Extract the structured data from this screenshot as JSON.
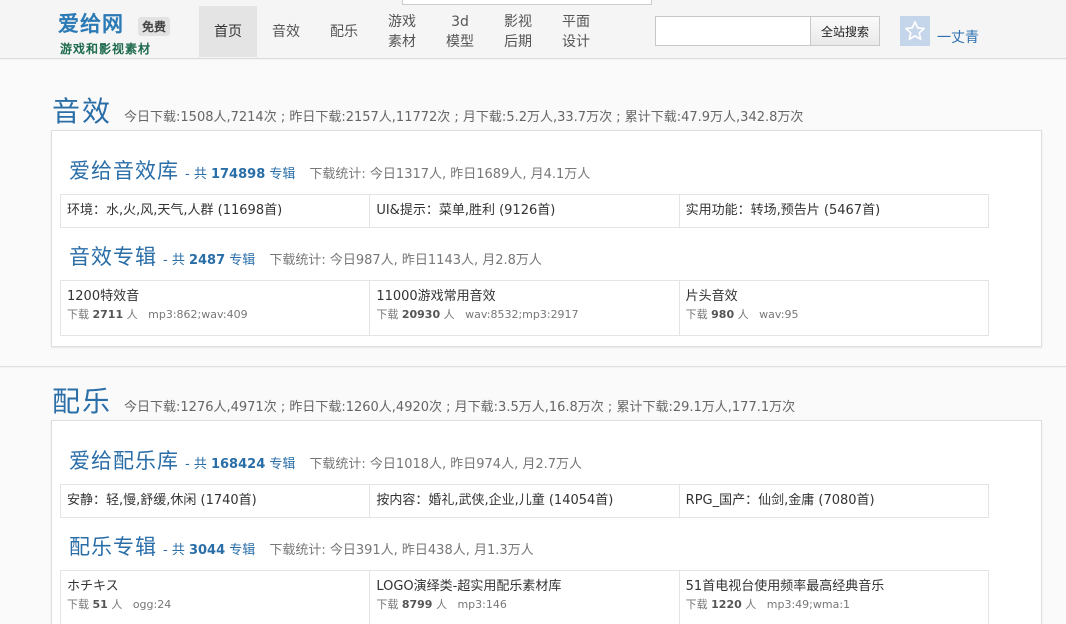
{
  "header": {
    "logo_title": "爱给网",
    "logo_badge": "免费",
    "logo_sub": "游戏和影视素材",
    "nav": [
      {
        "label": "首页"
      },
      {
        "label": "音效"
      },
      {
        "label": "配乐"
      },
      {
        "label": "游戏\n素材"
      },
      {
        "label": "3d\n模型"
      },
      {
        "label": "影视\n后期"
      },
      {
        "label": "平面\n设计"
      }
    ],
    "search": {
      "placeholder": "",
      "button": "全站搜索"
    },
    "user": {
      "name": "一丈青",
      "avatar_icon": "star-icon"
    }
  },
  "sound": {
    "title": "音效",
    "stats": "今日下载:1508人,7214次 ; 昨日下载:2157人,11772次 ; 月下载:5.2万人,33.7万次 ; 累计下载:47.9万人,342.8万次",
    "library": {
      "title": "爱给音效库",
      "count_prefix": "- 共",
      "count": "174898",
      "count_suffix": "专辑",
      "stats": "下载统计: 今日1317人, 昨日1689人, 月4.1万人",
      "categories": [
        "环境：水,火,风,天气,人群 (11698首)",
        "UI&提示：菜单,胜利 (9126首)",
        "实用功能：转场,预告片 (5467首)"
      ]
    },
    "albums": {
      "title": "音效专辑",
      "count_prefix": "- 共",
      "count": "2487",
      "count_suffix": "专辑",
      "stats": "下载统计: 今日987人, 昨日1143人, 月2.8万人",
      "items": [
        {
          "name": "1200特效音",
          "dl_prefix": "下载",
          "downloads": "2711",
          "dl_suffix": "人",
          "formats": "mp3:862;wav:409"
        },
        {
          "name": "11000游戏常用音效",
          "dl_prefix": "下载",
          "downloads": "20930",
          "dl_suffix": "人",
          "formats": "wav:8532;mp3:2917"
        },
        {
          "name": "片头音效",
          "dl_prefix": "下载",
          "downloads": "980",
          "dl_suffix": "人",
          "formats": "wav:95"
        }
      ]
    }
  },
  "music": {
    "title": "配乐",
    "stats": "今日下载:1276人,4971次 ; 昨日下载:1260人,4920次 ; 月下载:3.5万人,16.8万次 ; 累计下载:29.1万人,177.1万次",
    "library": {
      "title": "爱给配乐库",
      "count_prefix": "- 共",
      "count": "168424",
      "count_suffix": "专辑",
      "stats": "下载统计: 今日1018人, 昨日974人, 月2.7万人",
      "categories": [
        "安静：轻,慢,舒缓,休闲 (1740首)",
        "按内容：婚礼,武侠,企业,儿童 (14054首)",
        "RPG_国产：仙剑,金庸 (7080首)"
      ]
    },
    "albums": {
      "title": "配乐专辑",
      "count_prefix": "- 共",
      "count": "3044",
      "count_suffix": "专辑",
      "stats": "下载统计: 今日391人, 昨日438人, 月1.3万人",
      "items": [
        {
          "name": "ホチキス",
          "dl_prefix": "下载",
          "downloads": "51",
          "dl_suffix": "人",
          "formats": "ogg:24"
        },
        {
          "name": "LOGO演绎类-超实用配乐素材库",
          "dl_prefix": "下载",
          "downloads": "8799",
          "dl_suffix": "人",
          "formats": "mp3:146"
        },
        {
          "name": "51首电视台使用频率最高经典音乐",
          "dl_prefix": "下载",
          "downloads": "1220",
          "dl_suffix": "人",
          "formats": "mp3:49;wma:1"
        }
      ]
    }
  }
}
